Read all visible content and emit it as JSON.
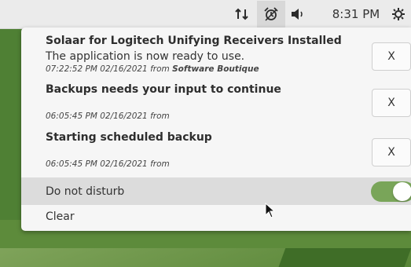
{
  "topbar": {
    "clock": "8:31 PM",
    "icons": [
      "network-arrows-icon",
      "alarm-clock-icon",
      "volume-icon",
      "system-menu-icon"
    ]
  },
  "notifications": [
    {
      "title": "Solaar for Logitech Unifying Receivers Installed",
      "body": "The application is now ready to use.",
      "time": "07:22:52 PM 02/16/2021 from",
      "source": "Software Boutique",
      "close_label": "X"
    },
    {
      "title": "Backups needs your input to continue",
      "body": "",
      "time": "06:05:45 PM 02/16/2021 from",
      "source": "",
      "close_label": "X"
    },
    {
      "title": "Starting scheduled backup",
      "body": "",
      "time": "06:05:45 PM 02/16/2021 from",
      "source": "",
      "close_label": "X"
    }
  ],
  "dnd": {
    "label": "Do not disturb",
    "enabled": true
  },
  "clear": {
    "label": "Clear"
  },
  "colors": {
    "toggle_on": "#79a559",
    "panel": "#ebebeb",
    "popup": "#f6f6f6"
  }
}
